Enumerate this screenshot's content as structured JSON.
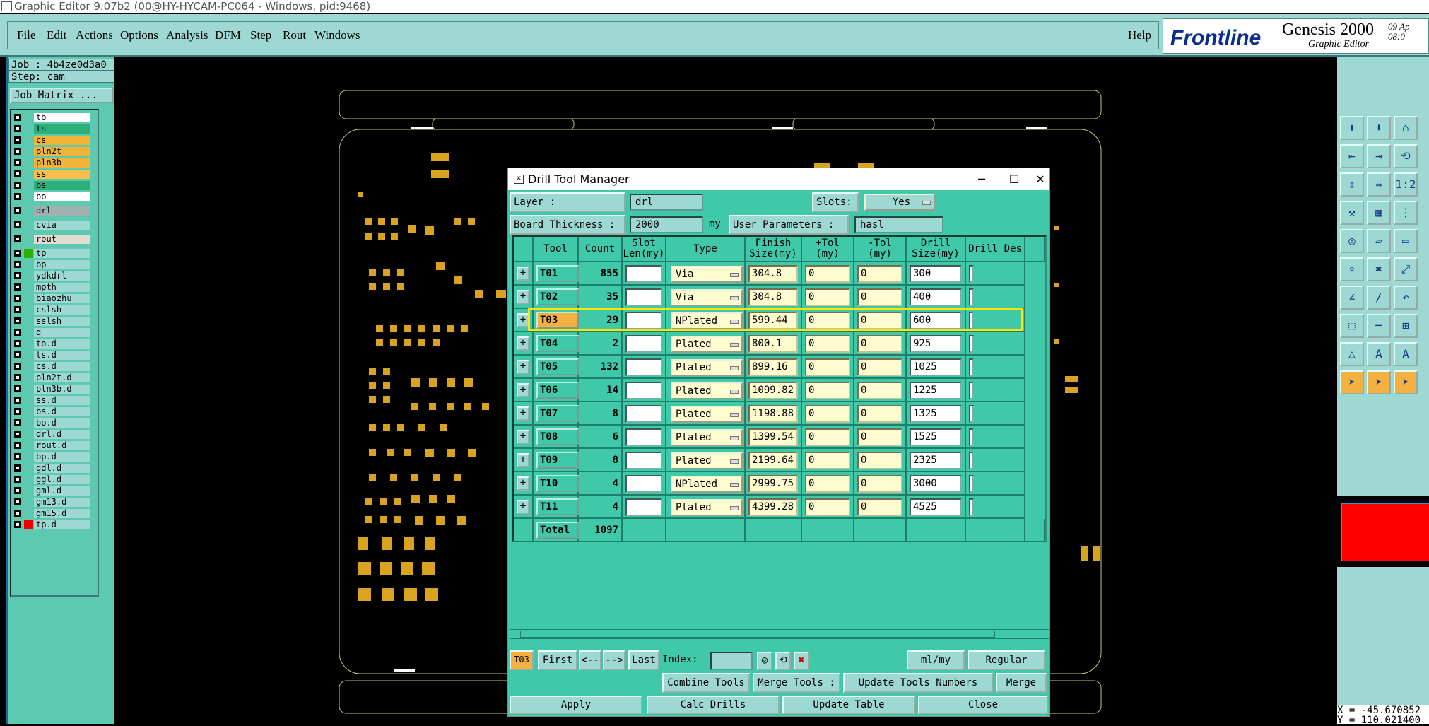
{
  "window": {
    "title": "Graphic Editor 9.07b2 (00@HY-HYCAM-PC064 - Windows, pid:9468)"
  },
  "menu": {
    "items": [
      "File",
      "Edit",
      "Actions",
      "Options",
      "Analysis",
      "DFM",
      "Step",
      "Rout",
      "Windows"
    ],
    "help": "Help"
  },
  "brand": {
    "company": "Frontline",
    "product": "Genesis 2000",
    "subtitle": "Graphic Editor",
    "date_line1": "09 Ap",
    "date_line2": "08:0"
  },
  "job": {
    "job": "Job : 4b4ze0d3a0",
    "step": "Step: cam",
    "matrix_button": "Job Matrix ..."
  },
  "layers": [
    {
      "name": "to",
      "color": "#ffffff"
    },
    {
      "name": "ts",
      "color": "#2bb079"
    },
    {
      "name": "cs",
      "color": "#f2b437"
    },
    {
      "name": "pln2t",
      "color": "#f2b437"
    },
    {
      "name": "pln3b",
      "color": "#f2b437"
    },
    {
      "name": "ss",
      "color": "#f7c04a"
    },
    {
      "name": "bs",
      "color": "#2bb079"
    },
    {
      "name": "bo",
      "color": "#ffffff"
    },
    {
      "name": "drl",
      "color": "#9fb0b0"
    },
    {
      "name": "cvia",
      "color": "#9ed8d3"
    },
    {
      "name": "rout",
      "color": "#e2ddd2"
    },
    {
      "name": "tp",
      "color": "#9ed8d3"
    },
    {
      "name": "bp",
      "color": "#9ed8d3"
    },
    {
      "name": "ydkdrl",
      "color": "#9ed8d3"
    },
    {
      "name": "mpth",
      "color": "#9ed8d3"
    },
    {
      "name": "biaozhu",
      "color": "#9ed8d3"
    },
    {
      "name": "cslsh",
      "color": "#9ed8d3"
    },
    {
      "name": "sslsh",
      "color": "#9ed8d3"
    },
    {
      "name": "d",
      "color": "#9ed8d3"
    },
    {
      "name": "to.d",
      "color": "#9ed8d3"
    },
    {
      "name": "ts.d",
      "color": "#9ed8d3"
    },
    {
      "name": "cs.d",
      "color": "#9ed8d3"
    },
    {
      "name": "pln2t.d",
      "color": "#9ed8d3"
    },
    {
      "name": "pln3b.d",
      "color": "#9ed8d3"
    },
    {
      "name": "ss.d",
      "color": "#9ed8d3"
    },
    {
      "name": "bs.d",
      "color": "#9ed8d3"
    },
    {
      "name": "bo.d",
      "color": "#9ed8d3"
    },
    {
      "name": "drl.d",
      "color": "#9ed8d3"
    },
    {
      "name": "rout.d",
      "color": "#9ed8d3"
    },
    {
      "name": "bp.d",
      "color": "#9ed8d3"
    },
    {
      "name": "gdl.d",
      "color": "#9ed8d3"
    },
    {
      "name": "ggl.d",
      "color": "#9ed8d3"
    },
    {
      "name": "gml.d",
      "color": "#9ed8d3"
    },
    {
      "name": "gm13.d",
      "color": "#9ed8d3"
    },
    {
      "name": "gm15.d",
      "color": "#9ed8d3"
    },
    {
      "name": "tp.d",
      "color": "#9ed8d3"
    }
  ],
  "coords": {
    "x": "X = -45.670852",
    "y": "Y = 110.021400"
  },
  "dialog": {
    "title": "Drill Tool Manager",
    "layer_label": "Layer           :",
    "layer_value": "drl",
    "slots_label": "Slots:",
    "slots_value": "Yes",
    "thickness_label": "Board Thickness :",
    "thickness_value": "2000",
    "thickness_unit": "my",
    "user_params_label": "User Parameters :",
    "user_params_value": "hasl",
    "headers": [
      "Tool",
      "Count",
      "Slot Len(my)",
      "Type",
      "Finish Size(my)",
      "+Tol (my)",
      "-Tol (my)",
      "Drill Size(my)",
      "Drill Des"
    ],
    "tools": [
      {
        "tool": "T01",
        "count": "855",
        "type": "Via",
        "finish": "304.8",
        "ptol": "0",
        "ntol": "0",
        "drill": "300"
      },
      {
        "tool": "T02",
        "count": "35",
        "type": "Via",
        "finish": "304.8",
        "ptol": "0",
        "ntol": "0",
        "drill": "400"
      },
      {
        "tool": "T03",
        "count": "29",
        "type": "NPlated",
        "finish": "599.44",
        "ptol": "0",
        "ntol": "0",
        "drill": "600"
      },
      {
        "tool": "T04",
        "count": "2",
        "type": "Plated",
        "finish": "800.1",
        "ptol": "0",
        "ntol": "0",
        "drill": "925"
      },
      {
        "tool": "T05",
        "count": "132",
        "type": "Plated",
        "finish": "899.16",
        "ptol": "0",
        "ntol": "0",
        "drill": "1025"
      },
      {
        "tool": "T06",
        "count": "14",
        "type": "Plated",
        "finish": "1099.82",
        "ptol": "0",
        "ntol": "0",
        "drill": "1225"
      },
      {
        "tool": "T07",
        "count": "8",
        "type": "Plated",
        "finish": "1198.88",
        "ptol": "0",
        "ntol": "0",
        "drill": "1325"
      },
      {
        "tool": "T08",
        "count": "6",
        "type": "Plated",
        "finish": "1399.54",
        "ptol": "0",
        "ntol": "0",
        "drill": "1525"
      },
      {
        "tool": "T09",
        "count": "8",
        "type": "Plated",
        "finish": "2199.64",
        "ptol": "0",
        "ntol": "0",
        "drill": "2325"
      },
      {
        "tool": "T10",
        "count": "4",
        "type": "NPlated",
        "finish": "2999.75",
        "ptol": "0",
        "ntol": "0",
        "drill": "3000"
      },
      {
        "tool": "T11",
        "count": "4",
        "type": "Plated",
        "finish": "4399.28",
        "ptol": "0",
        "ntol": "0",
        "drill": "4525"
      }
    ],
    "total_label": "Total",
    "total_count": "1097",
    "nav": {
      "current": "T03",
      "first": "First",
      "prev": "<--",
      "next": "-->",
      "last": "Last",
      "index_label": "Index:",
      "units": "ml/my",
      "mode": "Regular"
    },
    "actions": {
      "combine": "Combine Tools",
      "merge_tools": "Merge Tools :",
      "update_numbers": "Update Tools Numbers",
      "merge": "Merge"
    },
    "footer": {
      "apply": "Apply",
      "calc": "Calc Drills",
      "update": "Update Table",
      "close": "Close"
    }
  },
  "colors": {
    "panel": "#9ed8d3",
    "dialog": "#3fc9a8",
    "pad": "#d9a21f",
    "highlight": "#ffe600"
  }
}
